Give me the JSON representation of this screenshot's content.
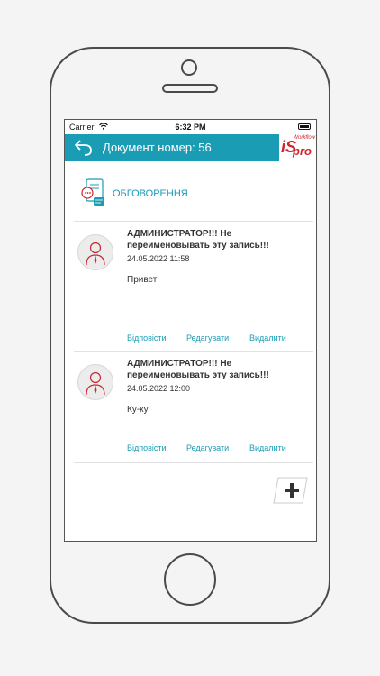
{
  "status_bar": {
    "carrier": "Carrier",
    "time": "6:32 PM"
  },
  "header": {
    "title": "Документ номер: 56",
    "logo_text_is": "iS",
    "logo_text_pro": "pro",
    "logo_text_workflow": "Workflow"
  },
  "section": {
    "title": "ОБГОВОРЕННЯ"
  },
  "comments": [
    {
      "author": "АДМИНИСТРАТОР!!! Не переименовывать эту запись!!!",
      "date": "24.05.2022 11:58",
      "text": "Привет",
      "actions": {
        "reply": "Відповісти",
        "edit": "Редагувати",
        "delete": "Видалити"
      }
    },
    {
      "author": "АДМИНИСТРАТОР!!! Не переименовывать эту запись!!!",
      "date": "24.05.2022 12:00",
      "text": "Ку-ку",
      "actions": {
        "reply": "Відповісти",
        "edit": "Редагувати",
        "delete": "Видалити"
      }
    }
  ],
  "colors": {
    "accent": "#1a9cb5",
    "brand_red": "#d2222a"
  },
  "icons": [
    "wifi-icon",
    "battery-icon",
    "back-arrow-icon",
    "discussion-icon",
    "user-avatar-icon",
    "plus-icon"
  ]
}
